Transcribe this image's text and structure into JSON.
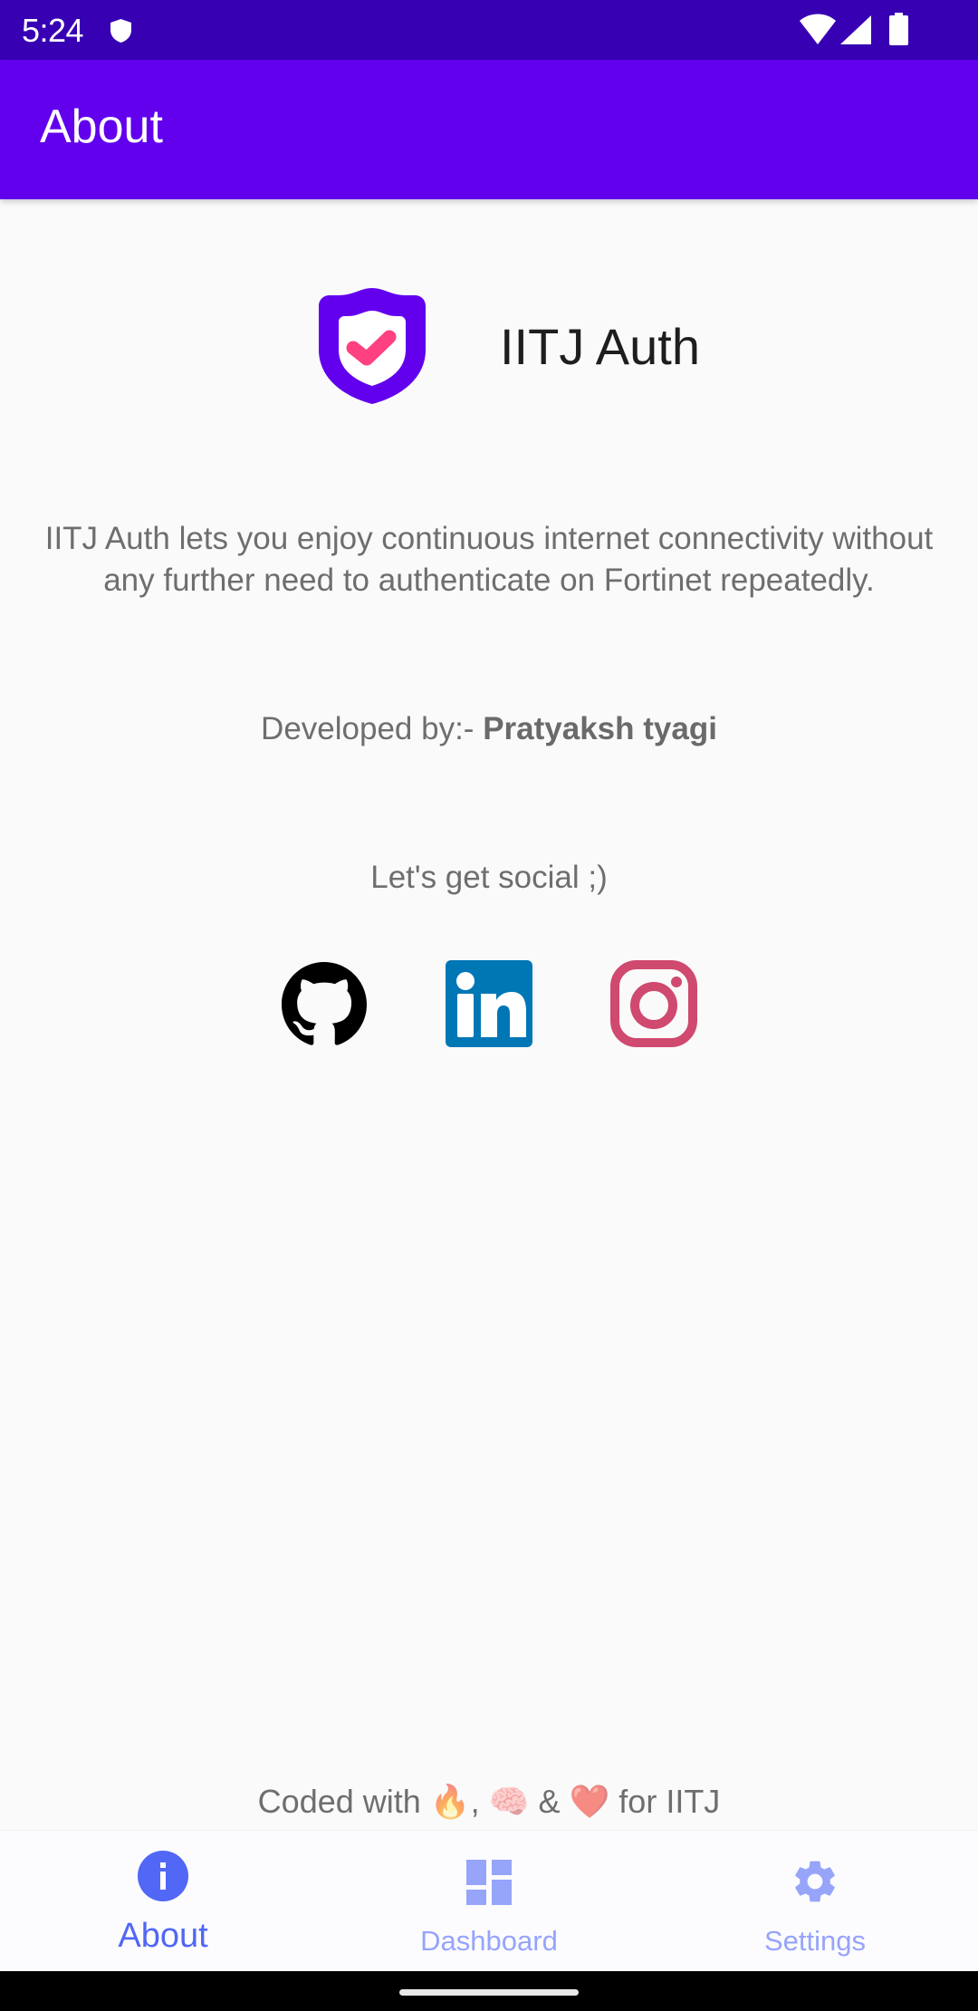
{
  "status_bar": {
    "time": "5:24",
    "icons": [
      "shield-icon",
      "wifi-icon",
      "signal-icon",
      "battery-icon"
    ]
  },
  "app_bar": {
    "title": "About"
  },
  "app_info": {
    "name": "IITJ Auth",
    "logo_icon": "shield-check-icon",
    "description": "IITJ Auth lets you enjoy continuous internet connectivity without any further need to authenticate on Fortinet repeatedly.",
    "developed_by_label": "Developed by:- ",
    "developer_name": "Pratyaksh tyagi"
  },
  "social": {
    "label": "Let's get social ;)",
    "links": [
      {
        "name": "GitHub",
        "icon": "github-icon"
      },
      {
        "name": "LinkedIn",
        "icon": "linkedin-icon"
      },
      {
        "name": "Instagram",
        "icon": "instagram-icon"
      }
    ]
  },
  "footer": {
    "prefix": "Coded with ",
    "emoji_fire": "🔥",
    "sep1": ", ",
    "emoji_brain": "🧠",
    "sep2": " & ",
    "emoji_heart": "❤️",
    "suffix": " for IITJ"
  },
  "bottom_nav": {
    "active": "About",
    "items": [
      {
        "label": "About",
        "icon": "info-icon"
      },
      {
        "label": "Dashboard",
        "icon": "dashboard-icon"
      },
      {
        "label": "Settings",
        "icon": "gear-icon"
      }
    ]
  },
  "colors": {
    "status_bar": "#3700B3",
    "primary": "#6200EE",
    "accent_pink": "#FF4081",
    "nav_active": "#5167F5",
    "nav_inactive": "#96A4FA",
    "text_secondary": "#6E6E6E",
    "linkedin": "#0077B5",
    "instagram": "#D0496F"
  }
}
